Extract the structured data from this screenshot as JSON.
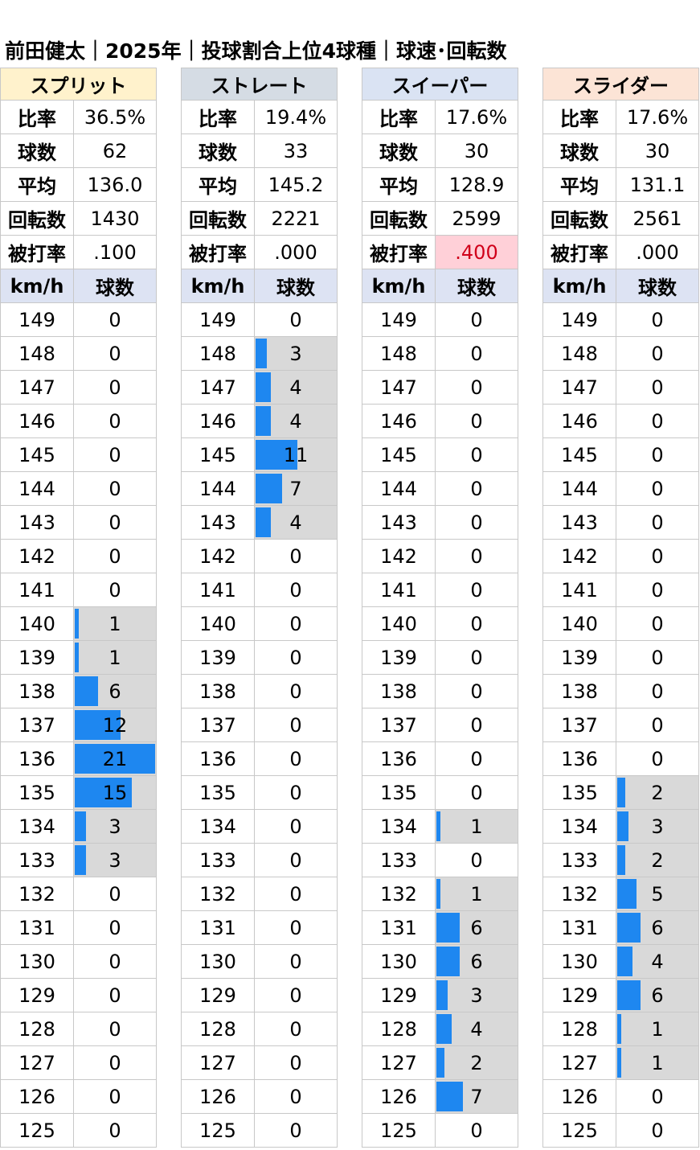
{
  "title": "前田健太｜2025年｜投球割合上位4球種｜球速･回転数",
  "labels": {
    "ratio": "比率",
    "count": "球数",
    "avg": "平均",
    "spin": "回転数",
    "ba": "被打率",
    "speed_col": "km/h",
    "count_col": "球数"
  },
  "colors": {
    "bar": "#1e87f0",
    "bar_bg": "#d9d9d9",
    "highlight_bg": "#ffd0d8",
    "highlight_text": "#d0001a",
    "column_header_bg": "#dde3f3"
  },
  "chart_data": {
    "type": "bar",
    "speeds": [
      "149",
      "148",
      "147",
      "146",
      "145",
      "144",
      "143",
      "142",
      "141",
      "140",
      "139",
      "138",
      "137",
      "136",
      "135",
      "134",
      "133",
      "132",
      "131",
      "130",
      "129",
      "128",
      "127",
      "126",
      "125"
    ],
    "bar_max": 21,
    "pitches": [
      {
        "name": "スプリット",
        "header_color": "#fff2cc",
        "ratio": "36.5%",
        "count": "62",
        "avg": "136.0",
        "spin": "1430",
        "ba": ".100",
        "ba_highlight": false,
        "counts": [
          0,
          0,
          0,
          0,
          0,
          0,
          0,
          0,
          0,
          1,
          1,
          6,
          12,
          21,
          15,
          3,
          3,
          0,
          0,
          0,
          0,
          0,
          0,
          0,
          0
        ]
      },
      {
        "name": "ストレート",
        "header_color": "#d5dce4",
        "ratio": "19.4%",
        "count": "33",
        "avg": "145.2",
        "spin": "2221",
        "ba": ".000",
        "ba_highlight": false,
        "counts": [
          0,
          3,
          4,
          4,
          11,
          7,
          4,
          0,
          0,
          0,
          0,
          0,
          0,
          0,
          0,
          0,
          0,
          0,
          0,
          0,
          0,
          0,
          0,
          0,
          0
        ]
      },
      {
        "name": "スイーパー",
        "header_color": "#dae3f3",
        "ratio": "17.6%",
        "count": "30",
        "avg": "128.9",
        "spin": "2599",
        "ba": ".400",
        "ba_highlight": true,
        "counts": [
          0,
          0,
          0,
          0,
          0,
          0,
          0,
          0,
          0,
          0,
          0,
          0,
          0,
          0,
          0,
          1,
          0,
          1,
          6,
          6,
          3,
          4,
          2,
          7,
          0
        ]
      },
      {
        "name": "スライダー",
        "header_color": "#fce4d6",
        "ratio": "17.6%",
        "count": "30",
        "avg": "131.1",
        "spin": "2561",
        "ba": ".000",
        "ba_highlight": false,
        "counts": [
          0,
          0,
          0,
          0,
          0,
          0,
          0,
          0,
          0,
          0,
          0,
          0,
          0,
          0,
          2,
          3,
          2,
          5,
          6,
          4,
          6,
          1,
          1,
          0,
          0
        ]
      }
    ]
  }
}
